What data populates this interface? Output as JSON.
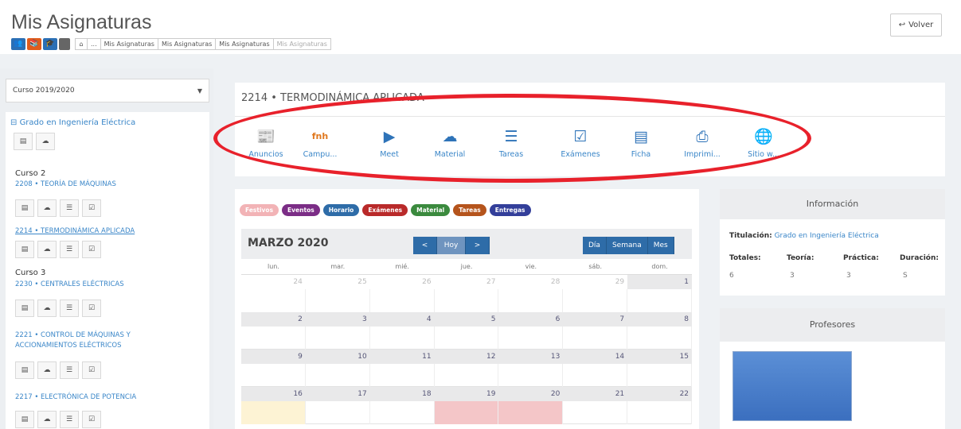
{
  "header": {
    "title": "Mis Asignaturas",
    "back_label": "Volver",
    "breadcrumbs": [
      "...",
      "Mis Asignaturas",
      "Mis Asignaturas",
      "Mis Asignaturas",
      "Mis Asignaturas"
    ]
  },
  "sidebar": {
    "course_year": "Curso 2019/2020",
    "degree": "Grado en Ingeniería Eléctrica",
    "groups": [
      {
        "year": "Curso 2",
        "subjects": [
          "2208 • TEORÍA DE MÁQUINAS",
          "2214 • TERMODINÁMICA APLICADA"
        ]
      },
      {
        "year": "Curso 3",
        "subjects": [
          "2230 • CENTRALES ELÉCTRICAS",
          "2221 • CONTROL DE MÁQUINAS Y ACCIONAMIENTOS ELÉCTRICOS",
          "2217 • ELECTRÓNICA DE POTENCIA"
        ]
      }
    ]
  },
  "course": {
    "title": "2214 • TERMODINÁMICA APLICADA",
    "tools": [
      "Anuncios",
      "Campu...",
      "Meet",
      "Material",
      "Tareas",
      "Exámenes",
      "Ficha",
      "Imprimi...",
      "Sitio w..."
    ]
  },
  "legend": [
    {
      "label": "Festivos",
      "color": "#f2b3b6"
    },
    {
      "label": "Eventos",
      "color": "#7b2d86"
    },
    {
      "label": "Horario",
      "color": "#2e6ca8"
    },
    {
      "label": "Exámenes",
      "color": "#b92a2a"
    },
    {
      "label": "Material",
      "color": "#3b8a3e"
    },
    {
      "label": "Tareas",
      "color": "#b5541c"
    },
    {
      "label": "Entregas",
      "color": "#333f9a"
    }
  ],
  "calendar": {
    "month": "MARZO 2020",
    "today": "Hoy",
    "prev": "<",
    "next": ">",
    "views": [
      "Día",
      "Semana",
      "Mes"
    ],
    "weekdays": [
      "lun.",
      "mar.",
      "mié.",
      "jue.",
      "vie.",
      "sáb.",
      "dom."
    ],
    "weeks": [
      [
        "24",
        "25",
        "26",
        "27",
        "28",
        "29",
        "1"
      ],
      [
        "2",
        "3",
        "4",
        "5",
        "6",
        "7",
        "8"
      ],
      [
        "9",
        "10",
        "11",
        "12",
        "13",
        "14",
        "15"
      ],
      [
        "16",
        "17",
        "18",
        "19",
        "20",
        "21",
        "22"
      ]
    ]
  },
  "info": {
    "title": "Información",
    "degree_label": "Titulación:",
    "degree_value": "Grado en Ingeniería Eléctrica",
    "stat_labels": [
      "Totales:",
      "Teoría:",
      "Práctica:",
      "Duración:"
    ],
    "stat_values": [
      "6",
      "3",
      "3",
      "S"
    ]
  },
  "professors": {
    "title": "Profesores"
  }
}
